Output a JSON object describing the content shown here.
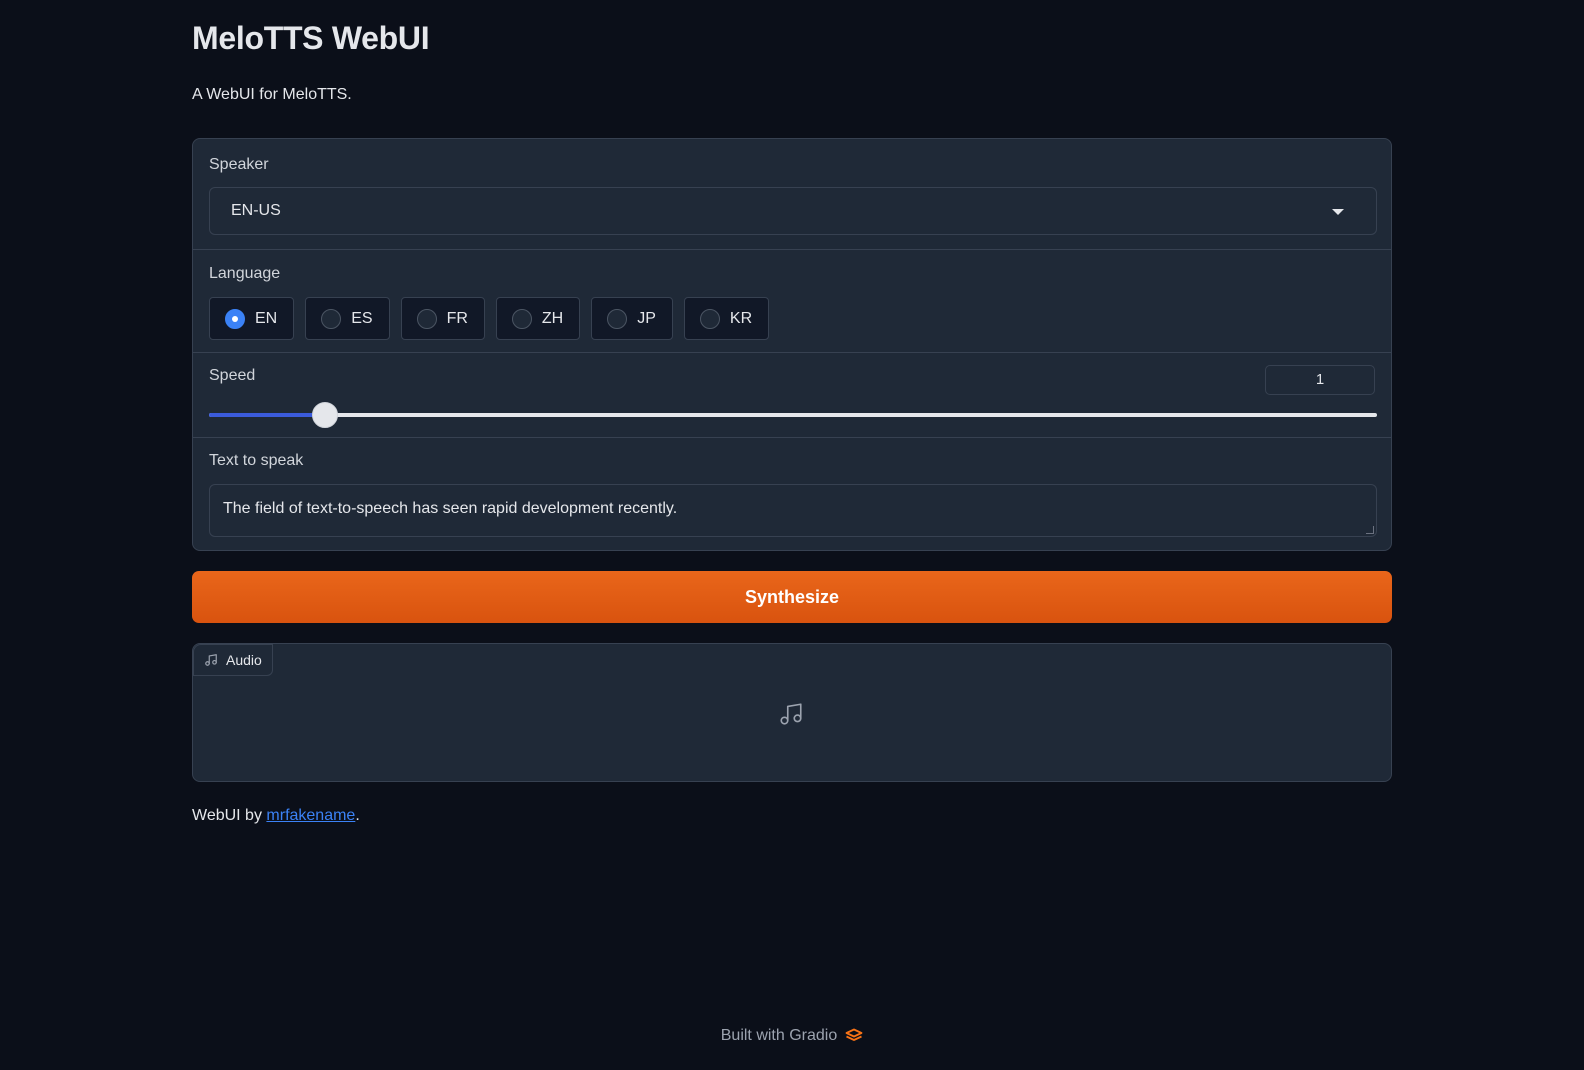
{
  "header": {
    "title": "MeloTTS WebUI",
    "subtitle": "A WebUI for MeloTTS."
  },
  "speaker": {
    "label": "Speaker",
    "value": "EN-US"
  },
  "language": {
    "label": "Language",
    "options": [
      "EN",
      "ES",
      "FR",
      "ZH",
      "JP",
      "KR"
    ],
    "selected": "EN"
  },
  "speed": {
    "label": "Speed",
    "value": "1",
    "fraction": 0.099
  },
  "text_input": {
    "label": "Text to speak",
    "value": "The field of text-to-speech has seen rapid development recently."
  },
  "synthesize": {
    "label": "Synthesize"
  },
  "audio": {
    "label": "Audio"
  },
  "footer": {
    "prefix": "WebUI by ",
    "link_text": "mrfakename",
    "suffix": ".",
    "built_with": "Built with Gradio"
  },
  "colors": {
    "background": "#0b0f19",
    "panel": "#1f2937",
    "accent": "#3b82f6",
    "primary_button": "#e9661a"
  }
}
